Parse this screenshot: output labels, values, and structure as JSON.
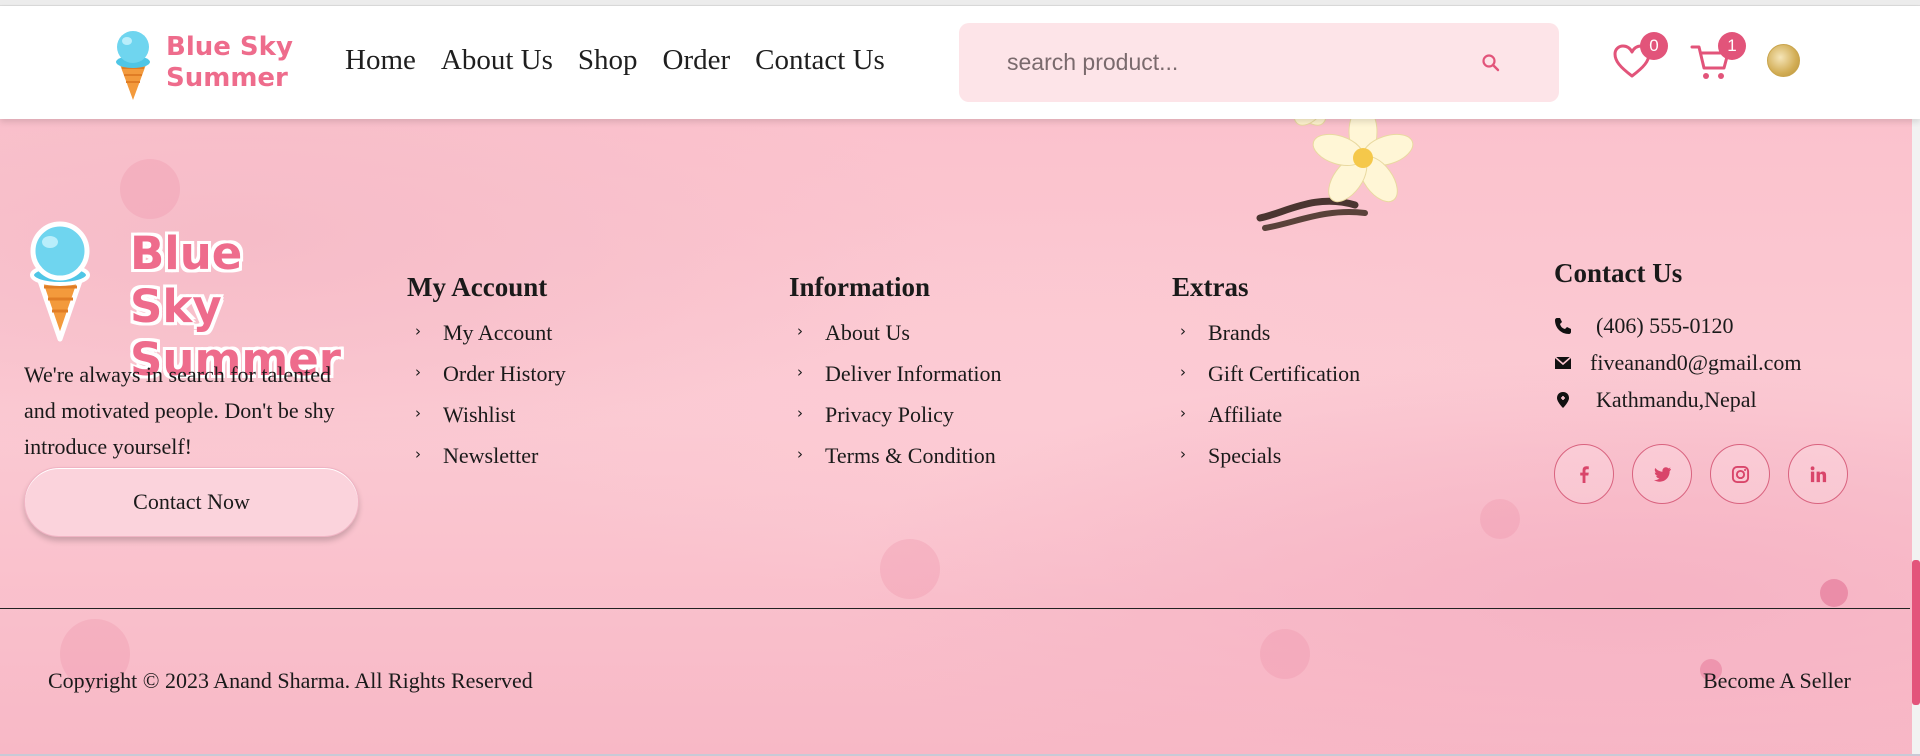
{
  "header": {
    "brand": {
      "line1": "Blue Sky",
      "line2": "Summer"
    },
    "nav": [
      "Home",
      "About Us",
      "Shop",
      "Order",
      "Contact Us"
    ],
    "search": {
      "placeholder": "search product...",
      "value": ""
    },
    "wishlist_count": "0",
    "cart_count": "1",
    "icons": [
      "heart-icon",
      "cart-icon",
      "search-icon",
      "user-emblem-icon"
    ]
  },
  "footer": {
    "brand": {
      "line1": "Blue Sky",
      "line2": "Summer"
    },
    "about": "We're always in search for talented and motivated people. Don't be shy introduce yourself!",
    "contact_button": "Contact Now",
    "columns": [
      {
        "title": "My Account",
        "items": [
          "My Account",
          "Order History",
          "Wishlist",
          "Newsletter"
        ]
      },
      {
        "title": "Information",
        "items": [
          "About Us",
          "Deliver Information",
          "Privacy Policy",
          "Terms & Condition"
        ]
      },
      {
        "title": "Extras",
        "items": [
          "Brands",
          "Gift Certification",
          "Affiliate",
          "Specials"
        ]
      }
    ],
    "contact": {
      "title": "Contact Us",
      "phone": "(406) 555-0120",
      "email": "fiveanand0@gmail.com",
      "address": "Kathmandu,Nepal"
    },
    "socials": [
      "facebook-icon",
      "twitter-icon",
      "instagram-icon",
      "linkedin-icon"
    ],
    "copyright": "Copyright © 2023 Anand Sharma. All Rights Reserved",
    "seller_link": "Become A Seller"
  },
  "colors": {
    "brand_pink": "#ee6c8c",
    "badge": "#e2547a",
    "search_bg": "#fde4e8",
    "footer_bg": "#fbc6d0"
  }
}
